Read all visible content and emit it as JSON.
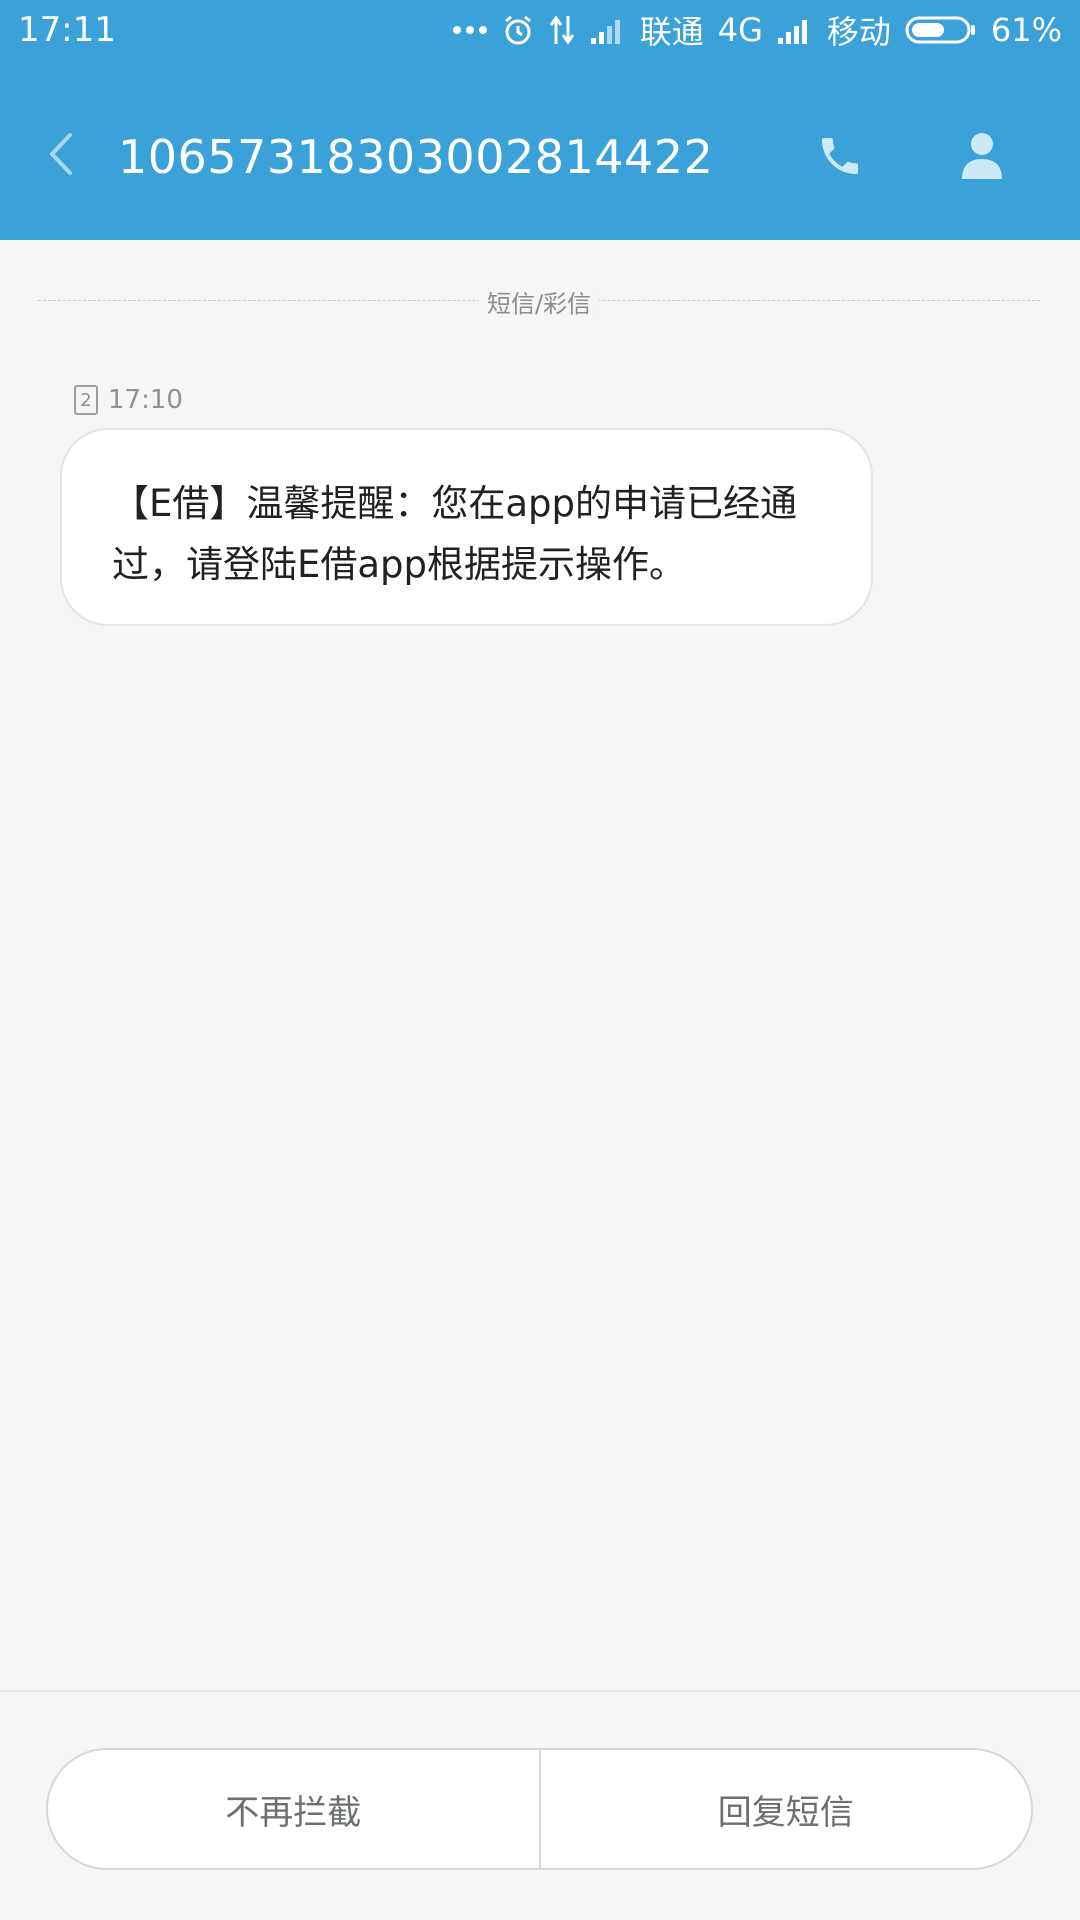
{
  "status_bar": {
    "time": "17:11",
    "carrier1": "联通",
    "network1": "4G",
    "carrier2": "移动",
    "battery": "61%",
    "battery_level": 0.61,
    "icons": [
      "more-dots-icon",
      "alarm-icon",
      "data-transfer-icon",
      "signal-icon",
      "signal-icon",
      "battery-icon"
    ]
  },
  "header": {
    "title": "10657318303002814422",
    "background": "#3aa2d8"
  },
  "conversation": {
    "divider_label": "短信/彩信",
    "messages": [
      {
        "sim": "2",
        "time": "17:10",
        "text": "【E借】温馨提醒：您在app的申请已经通过，请登陆E借app根据提示操作。"
      }
    ]
  },
  "bottom": {
    "unblock_label": "不再拦截",
    "reply_label": "回复短信"
  }
}
